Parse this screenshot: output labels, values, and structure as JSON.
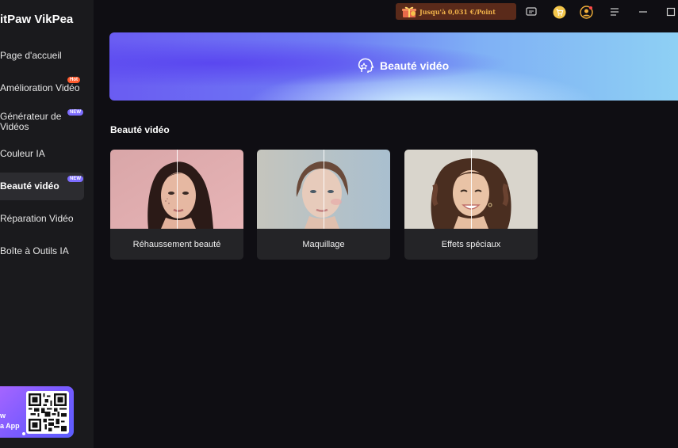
{
  "app": {
    "title": "itPaw VikPea"
  },
  "sidebar": {
    "items": [
      {
        "label": "Page d'accueil"
      },
      {
        "label": "Amélioration Vidéo",
        "badge": "Hot"
      },
      {
        "label_line1": "Générateur de",
        "label_line2": "Vidéos",
        "badge": "NEW"
      },
      {
        "label": "Couleur IA"
      },
      {
        "label": "Beauté vidéo",
        "badge": "NEW",
        "active": true
      },
      {
        "label": "Réparation Vidéo"
      },
      {
        "label": "Boîte à Outils IA"
      }
    ],
    "promo": {
      "line1": "w",
      "line2": "a App"
    }
  },
  "topbar": {
    "promo_text": "Jusqu'à 0,031 €/Point",
    "icons": [
      "chat-icon",
      "cart-icon",
      "account-icon",
      "menu-icon",
      "minimize-icon",
      "maximize-icon"
    ]
  },
  "banner": {
    "title": "Beauté vidéo",
    "icon": "beauty-face-icon"
  },
  "section": {
    "title": "Beauté vidéo"
  },
  "cards": [
    {
      "label": "Réhaussement beauté"
    },
    {
      "label": "Maquillage"
    },
    {
      "label": "Effets spéciaux"
    }
  ],
  "colors": {
    "accent": "#6a5cf2",
    "hot": "#ff5b2e",
    "new": "#7d6dff",
    "promo_text": "#f0b24a"
  }
}
